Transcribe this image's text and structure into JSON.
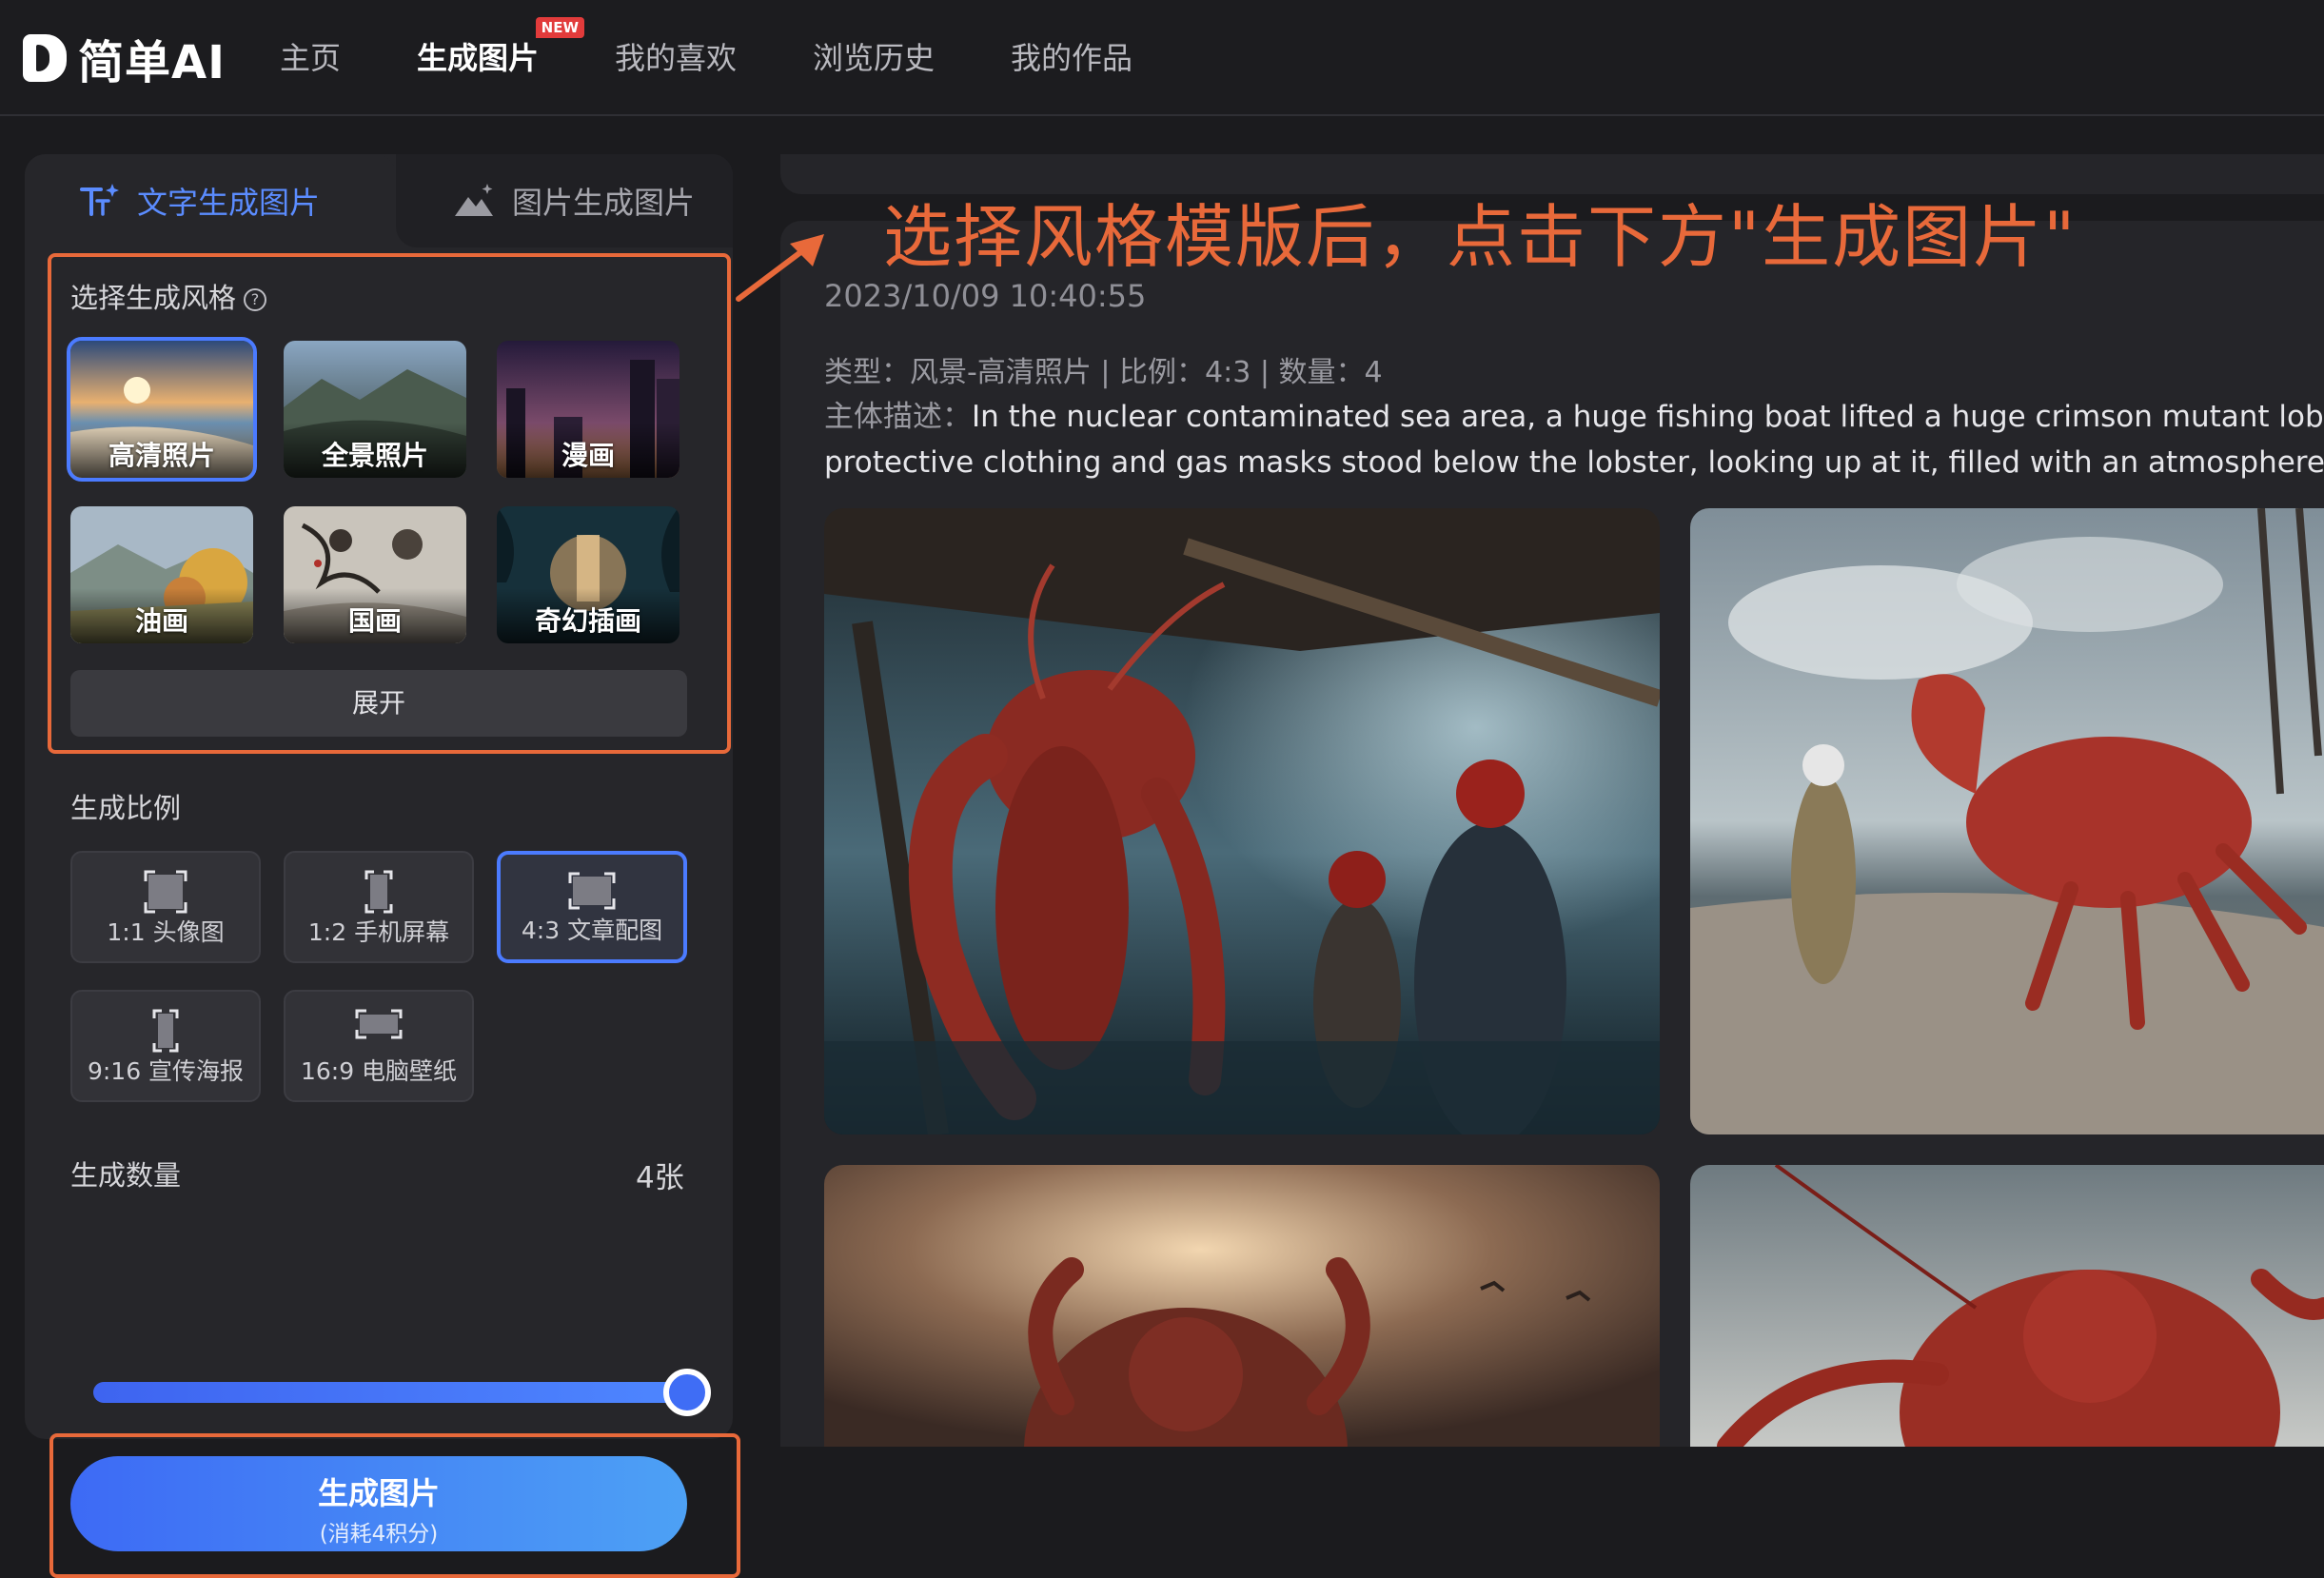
{
  "nav": {
    "logo_text": "简单AI",
    "items": [
      {
        "label": "主页"
      },
      {
        "label": "生成图片",
        "badge": "NEW"
      },
      {
        "label": "我的喜欢"
      },
      {
        "label": "浏览历史"
      },
      {
        "label": "我的作品"
      }
    ]
  },
  "left": {
    "tabs": [
      {
        "label": "文字生成图片",
        "active": true
      },
      {
        "label": "图片生成图片",
        "active": false
      }
    ],
    "style_section_label": "选择生成风格",
    "styles": [
      {
        "label": "高清照片",
        "selected": true
      },
      {
        "label": "全景照片",
        "selected": false
      },
      {
        "label": "漫画",
        "selected": false
      },
      {
        "label": "油画",
        "selected": false
      },
      {
        "label": "国画",
        "selected": false
      },
      {
        "label": "奇幻插画",
        "selected": false
      }
    ],
    "expand_label": "展开",
    "ratio_section_label": "生成比例",
    "ratios": [
      {
        "label": "1:1 头像图",
        "selected": false
      },
      {
        "label": "1:2 手机屏幕",
        "selected": false
      },
      {
        "label": "4:3 文章配图",
        "selected": true
      },
      {
        "label": "9:16 宣传海报",
        "selected": false
      },
      {
        "label": "16:9 电脑壁纸",
        "selected": false
      }
    ],
    "count_section_label": "生成数量",
    "count_value": "4张",
    "slider_fraction": 1.0,
    "generate_button": {
      "label": "生成图片",
      "sub_label": "(消耗4积分)"
    }
  },
  "right": {
    "annotation": "选择风格模版后，点击下方\"生成图片\"",
    "timestamp": "2023/10/09 10:40:55",
    "meta": "类型：风景-高清照片 | 比例：4:3 | 数量：4",
    "description_label": "主体描述：",
    "description_line1": "In the nuclear contaminated sea area, a huge fishing boat lifted a huge crimson mutant lobst",
    "description_line2": "protective clothing and gas masks stood below the lobster, looking up at it, filled with an atmosphere o"
  },
  "colors": {
    "accent_blue": "#4b7bff",
    "annotation_orange": "#e8693a",
    "new_badge_red": "#e23b3b"
  }
}
